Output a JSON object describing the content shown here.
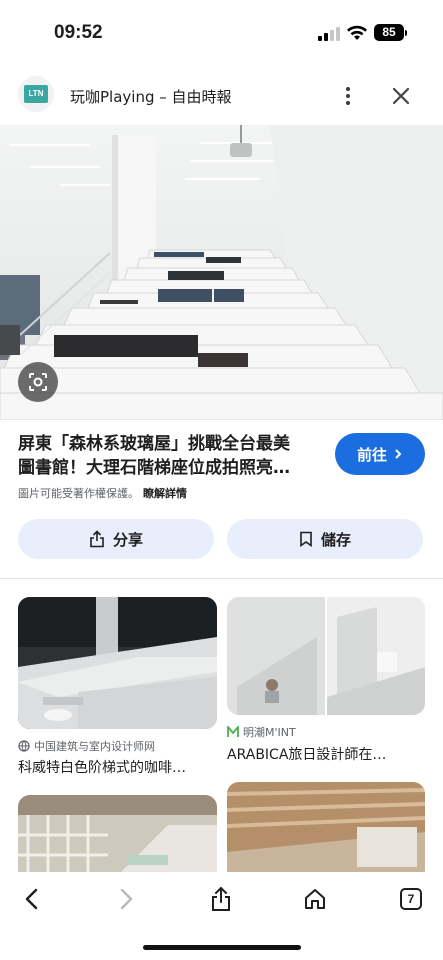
{
  "status": {
    "time": "09:52",
    "battery": "85"
  },
  "header": {
    "logo_text": "LTN",
    "title": "玩咖Playing – 自由時報"
  },
  "result": {
    "title_line1": "屏東「森林系玻璃屋」挑戰全台最美",
    "title_line2": "圖書館！大理石階梯座位成拍照亮…",
    "visit_label": "前往",
    "copyright": "圖片可能受著作權保護。",
    "learn_more": "瞭解詳情",
    "share_label": "分享",
    "save_label": "儲存"
  },
  "related": [
    {
      "source": "中国建筑与室内设计师网",
      "caption": "科威特白色阶梯式的咖啡…"
    },
    {
      "source": "明潮M'INT",
      "caption": "ARABICA旅日設計師在…"
    }
  ],
  "toolbar": {
    "tab_count": "7"
  },
  "icons": [
    "lens-icon",
    "share-icon",
    "bookmark-icon",
    "back-icon",
    "forward-icon",
    "home-icon",
    "close-icon",
    "more-icon"
  ]
}
